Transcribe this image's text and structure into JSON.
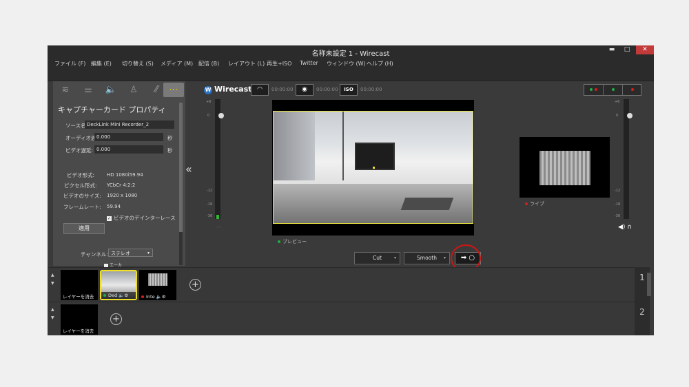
{
  "window": {
    "title": "名称未設定 1 - Wirecast",
    "min": "▬",
    "max": "□",
    "close": "✕"
  },
  "menu": [
    "ファイル (F)",
    "編集 (E)",
    "切り替え (S)",
    "メディア (M)",
    "配信 (B)",
    "レイアウト (L)",
    "再生+ISO",
    "Twitter",
    "ウィンドウ (W)",
    "ヘルプ (H)"
  ],
  "tabs": [
    {
      "name": "layers",
      "icon": "≋"
    },
    {
      "name": "settings",
      "icon": "⚌"
    },
    {
      "name": "audio",
      "icon": "🔈"
    },
    {
      "name": "person",
      "icon": "♙"
    },
    {
      "name": "title",
      "icon": "⁄⁄"
    },
    {
      "name": "more",
      "icon": "⋯"
    }
  ],
  "panel": {
    "title": "キャプチャーカード プロパティ",
    "source_label": "ソース名:",
    "source_value": "DeckLink Mini Recorder_2",
    "audio_delay_label": "オーディオ遅延:",
    "audio_delay_value": "0.000",
    "video_delay_label": "ビデオ遅延:",
    "video_delay_value": "0.000",
    "sec": "秒",
    "info": [
      {
        "label": "ビデオ形式:",
        "value": "HD 1080i59.94"
      },
      {
        "label": "ピクセル形式:",
        "value": "YCbCr 4:2:2"
      },
      {
        "label": "ビデオのサイズ:",
        "value": "1920 x 1080"
      },
      {
        "label": "フレームレート:",
        "value": "59.94"
      }
    ],
    "deinterlace_label": "ビデオのデインターレース",
    "apply_label": "適用",
    "channel_label": "チャンネル:",
    "channel_value": "ステレオ",
    "enable_label": "エーカ"
  },
  "topbar": {
    "brand": "Wirecast",
    "stream_icon": "wifi-icon",
    "stream_time": "00:00:00",
    "record_time": "00:00:00",
    "iso_label": "ISO",
    "iso_time": "00:00:00"
  },
  "meter_scale": [
    "+6",
    "0",
    "-6",
    "-12",
    "-18",
    "-24",
    "-36"
  ],
  "preview_label": "プレビュー",
  "live_label": "ライブ",
  "transition": {
    "cut": "Cut",
    "smooth": "Smooth",
    "go": "➡ ○"
  },
  "layers": [
    {
      "number": "1",
      "shots": [
        {
          "label": "レイヤーを消去",
          "status": ""
        },
        {
          "label": "Ded",
          "status": "green"
        },
        {
          "label": "Inte",
          "status": "red"
        }
      ]
    },
    {
      "number": "2",
      "shots": [
        {
          "label": "レイヤーを消去",
          "status": ""
        }
      ]
    }
  ],
  "colors": {
    "accent": "#f0e02a",
    "live": "#d02020",
    "preview": "#20b040",
    "highlight_ring": "#d01515"
  }
}
